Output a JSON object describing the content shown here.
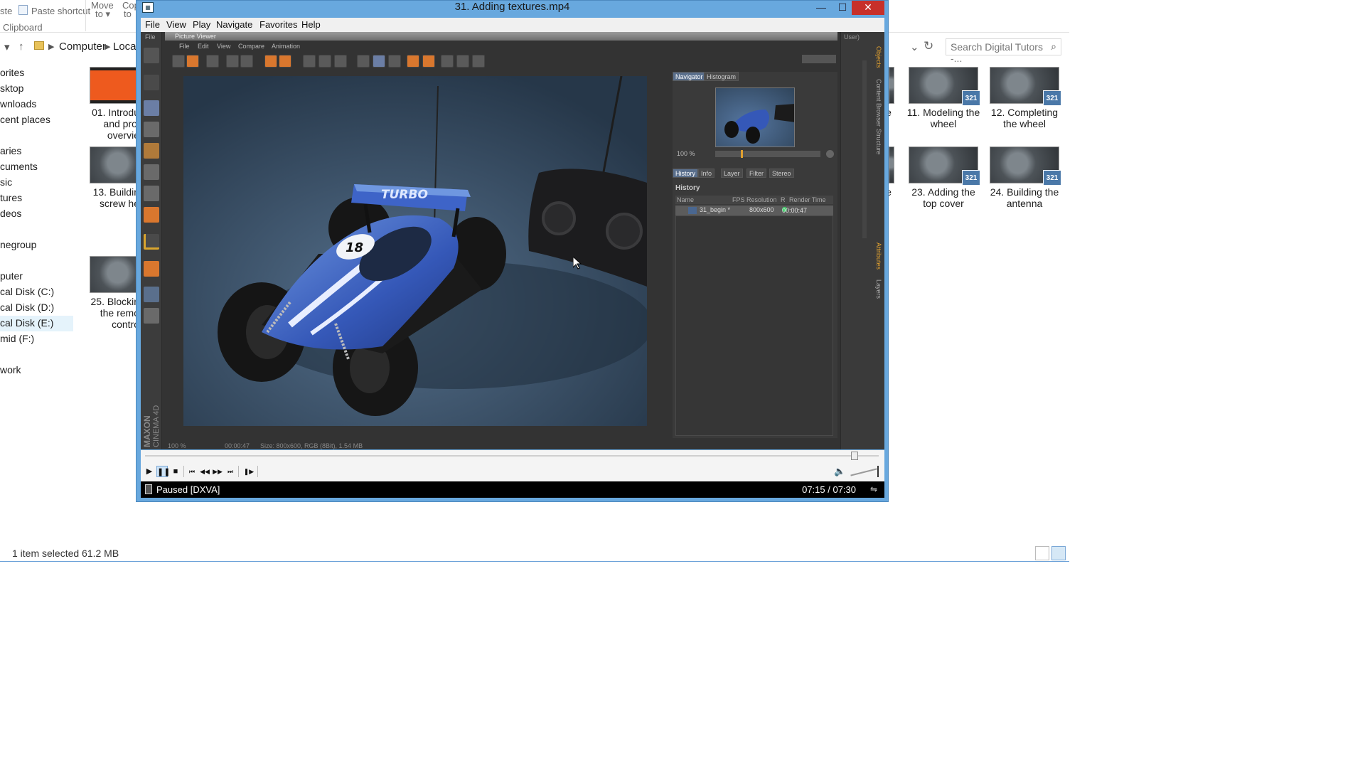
{
  "explorer": {
    "ribbon": {
      "paste_shortcut": "Paste shortcut",
      "clipboard": "Clipboard",
      "move_to_1": "Move",
      "move_to_2": "to ▾",
      "copy_to_1": "Cop",
      "copy_to_2": "to",
      "left_cut": "ste"
    },
    "address": {
      "computer": "Computer",
      "local": "Local"
    },
    "search_placeholder": "Search Digital Tutors -...",
    "nav": {
      "favorites": "orites",
      "desktop": "sktop",
      "downloads": "wnloads",
      "recent": "cent places",
      "libraries": "aries",
      "documents": "cuments",
      "music": "sic",
      "pictures": "tures",
      "videos": "deos",
      "homegroup": "negroup",
      "computer": "puter",
      "disk_c": "cal Disk (C:)",
      "disk_d": "cal Disk (D:)",
      "disk_e": "cal Disk (E:)",
      "disk_f": "mid (F:)",
      "network": "work"
    },
    "files_left": {
      "f01_l1": "01. Introdu",
      "f01_l2": "and proj",
      "f01_l3": "overvie",
      "f13_l1": "13. Buildin",
      "f13_l2": "screw he",
      "f25_l1": "25. Blockin",
      "f25_l2": "the remo",
      "f25_l3": "contro"
    },
    "files_right": {
      "f11_l1": "11. Modeling the",
      "f11_l2": "wheel",
      "f12_l1": "12. Completing",
      "f12_l2": "the wheel",
      "f23_l1": "23. Adding the",
      "f23_l2": "top cover",
      "f24_l1": "24. Building the",
      "f24_l2": "antenna",
      "cut_e1": "e",
      "cut_e2": "e"
    },
    "badge": "321",
    "status": "1 item selected  61.2 MB"
  },
  "player": {
    "title": "31. Adding textures.mp4",
    "menu": [
      "File",
      "View",
      "Play",
      "Navigate",
      "Favorites",
      "Help"
    ],
    "status_left": "Paused [DXVA]",
    "time": "07:15 / 07:30",
    "seek_fraction": 0.967
  },
  "c4d": {
    "file_label": "File",
    "picture_viewer_title": "Picture Viewer",
    "pv_menu": [
      "File",
      "Edit",
      "View",
      "Compare",
      "Animation"
    ],
    "user_label": "User)",
    "brand_1": "MAXON",
    "brand_2": "CINEMA 4D",
    "nav_tabs": [
      "Navigator",
      "Histogram"
    ],
    "zoom": "100 %",
    "hist_tabs": [
      "History",
      "Info",
      "Layer",
      "Filter",
      "Stereo"
    ],
    "history_heading": "History",
    "columns": [
      "Name",
      "FPS",
      "Resolution",
      "R",
      "Render Time"
    ],
    "row": {
      "name": "31_begin *",
      "resolution": "800x600",
      "time": "00:00:47"
    },
    "status_zoom": "100 %",
    "status_time": "00:00:47",
    "status_size": "Size: 800x600, RGB (8Bit), 1.54 MB",
    "dock_tabs": [
      "Objects",
      "Content Browser",
      "Structure",
      "Attributes",
      "Layers"
    ],
    "render": {
      "wing_text": "TURBO",
      "car_number": "18"
    }
  },
  "colors": {
    "title_blue": "#68a8de",
    "close_red": "#c7302a",
    "car_blue": "#3558b8",
    "accent_orange": "#d9772e"
  }
}
